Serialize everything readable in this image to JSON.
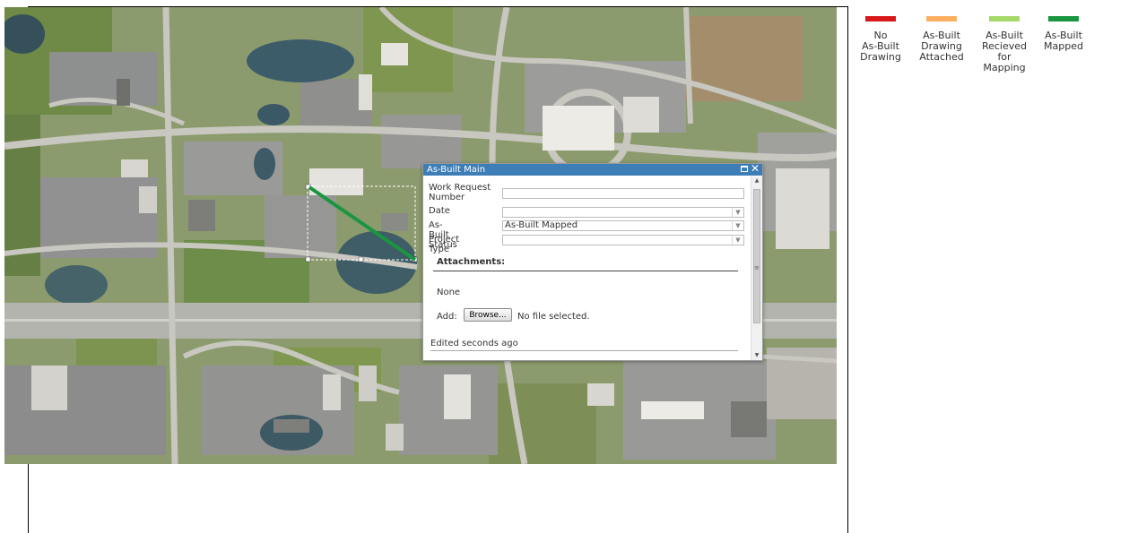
{
  "legend": {
    "items": [
      {
        "label": "No As-Built Drawing",
        "lines": [
          "No",
          "As-Built",
          "Drawing"
        ],
        "color": "#d7191c"
      },
      {
        "label": "As-Built Drawing Attached",
        "lines": [
          "As-Built",
          "Drawing",
          "Attached"
        ],
        "color": "#fdae61"
      },
      {
        "label": "As-Built Recieved for Mapping",
        "lines": [
          "As-Built",
          "Recieved",
          "for",
          "Mapping"
        ],
        "color": "#a6d96a"
      },
      {
        "label": "As-Built Mapped",
        "lines": [
          "As-Built",
          "Mapped"
        ],
        "color": "#1a9641"
      }
    ]
  },
  "popup": {
    "title": "As-Built Main",
    "fields": {
      "work_request_label": "Work Request Number",
      "work_request_value": "",
      "date_label": "Date",
      "date_value": "",
      "status_label": "As-Built Status",
      "status_value": "As-Built Mapped",
      "project_type_label": "Project Type",
      "project_type_value": ""
    },
    "attachments_title": "Attachments:",
    "attachments_value": "None",
    "add_label": "Add:",
    "browse_label": "Browse...",
    "no_file_text": "No file selected.",
    "edited_text": "Edited seconds ago"
  },
  "map": {
    "feature_color": "#1a9641",
    "icons": {
      "maximize": "maximize-icon",
      "close": "close-icon"
    }
  }
}
